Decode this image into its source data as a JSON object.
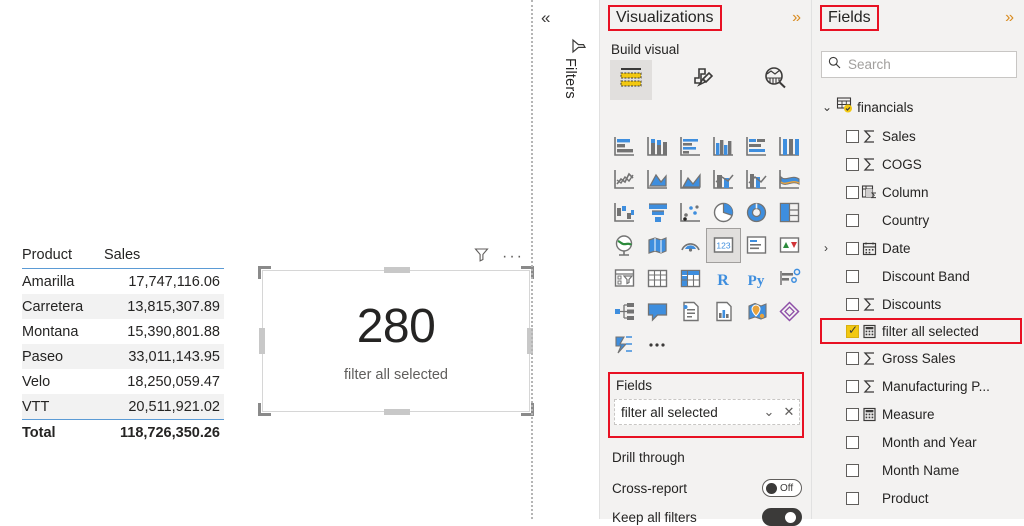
{
  "canvas": {
    "table_visual": {
      "columns": [
        "Product",
        "Sales"
      ],
      "rows": [
        {
          "product": "Amarilla",
          "sales": "17,747,116.06"
        },
        {
          "product": "Carretera",
          "sales": "13,815,307.89"
        },
        {
          "product": "Montana",
          "sales": "15,390,801.88"
        },
        {
          "product": "Paseo",
          "sales": "33,011,143.95"
        },
        {
          "product": "Velo",
          "sales": "18,250,059.47"
        },
        {
          "product": "VTT",
          "sales": "20,511,921.02"
        }
      ],
      "total_label": "Total",
      "total_value": "118,726,350.26"
    },
    "card_visual": {
      "value": "280",
      "label": "filter all selected",
      "filter_icon": "funnel-icon",
      "more_icon": "more-options-ellipsis"
    }
  },
  "filters_rail": {
    "collapse_label": "«",
    "filter_icon": "filter-funnel-icon",
    "label": "Filters"
  },
  "visualizations": {
    "title": "Visualizations",
    "expand_label": "»",
    "build_visual_label": "Build visual",
    "tabs": [
      {
        "name": "build-visual-tab",
        "icon": "build-visual-icon",
        "selected": true
      },
      {
        "name": "format-visual-tab",
        "icon": "paintbrush-icon",
        "selected": false
      },
      {
        "name": "analytics-tab",
        "icon": "magnifier-chart-icon",
        "selected": false
      }
    ],
    "chart_icons": [
      [
        "stacked-bar-chart",
        "stacked-column-chart",
        "clustered-bar-chart",
        "clustered-column-chart",
        "hundred-stacked-bar-chart",
        "hundred-stacked-column-chart"
      ],
      [
        "line-chart",
        "area-chart",
        "stacked-area-chart",
        "line-stacked-column-chart",
        "line-clustered-column-chart",
        "ribbon-chart"
      ],
      [
        "waterfall-chart",
        "funnel-chart",
        "scatter-chart",
        "pie-chart",
        "donut-chart",
        "treemap-chart"
      ],
      [
        "map-chart",
        "filled-map-chart",
        "azure-map-chart",
        "card-visual",
        "multi-row-card",
        "kpi-visual"
      ],
      [
        "slicer-visual",
        "table-visual",
        "matrix-visual",
        "r-script-visual",
        "python-visual",
        "key-influencers"
      ],
      [
        "decomposition-tree",
        "qna-visual",
        "smart-narrative",
        "paginated-report",
        "arcgis-maps",
        "power-apps"
      ],
      [
        "power-automate",
        "more-visuals-ellipsis"
      ]
    ],
    "selected_chart_icon": "card-visual",
    "fields_well": {
      "title": "Fields",
      "chip_value": "filter all selected",
      "chip_dropdown_icon": "chevron-down-icon",
      "chip_remove_icon": "close-icon"
    },
    "drill_through_label": "Drill through",
    "cross_report": {
      "label": "Cross-report",
      "state": "Off"
    },
    "keep_all_filters": {
      "label": "Keep all filters",
      "state": "On"
    }
  },
  "fields": {
    "title": "Fields",
    "expand_label": "»",
    "search": {
      "placeholder": "Search",
      "icon": "search-icon"
    },
    "table_node": {
      "name": "financials",
      "icon": "table-checked-icon",
      "chevron": "chevron-down-icon"
    },
    "items": [
      {
        "label": "Sales",
        "icon": "sigma-icon",
        "checked": false,
        "expandable": false,
        "highlighted": false
      },
      {
        "label": "COGS",
        "icon": "sigma-icon",
        "checked": false,
        "expandable": false,
        "highlighted": false
      },
      {
        "label": "Column",
        "icon": "calc-column-icon",
        "checked": false,
        "expandable": false,
        "highlighted": false
      },
      {
        "label": "Country",
        "icon": "none",
        "checked": false,
        "expandable": false,
        "highlighted": false
      },
      {
        "label": "Date",
        "icon": "calendar-icon",
        "checked": false,
        "expandable": true,
        "highlighted": false
      },
      {
        "label": "Discount Band",
        "icon": "none",
        "checked": false,
        "expandable": false,
        "highlighted": false
      },
      {
        "label": "Discounts",
        "icon": "sigma-icon",
        "checked": false,
        "expandable": false,
        "highlighted": false
      },
      {
        "label": "filter all selected",
        "icon": "measure-icon",
        "checked": true,
        "expandable": false,
        "highlighted": true
      },
      {
        "label": "Gross Sales",
        "icon": "sigma-icon",
        "checked": false,
        "expandable": false,
        "highlighted": false
      },
      {
        "label": "Manufacturing P...",
        "icon": "sigma-icon",
        "checked": false,
        "expandable": false,
        "highlighted": false
      },
      {
        "label": "Measure",
        "icon": "measure-icon",
        "checked": false,
        "expandable": false,
        "highlighted": false
      },
      {
        "label": "Month and Year",
        "icon": "none",
        "checked": false,
        "expandable": false,
        "highlighted": false
      },
      {
        "label": "Month Name",
        "icon": "none",
        "checked": false,
        "expandable": false,
        "highlighted": false
      },
      {
        "label": "Product",
        "icon": "none",
        "checked": false,
        "expandable": false,
        "highlighted": false
      }
    ]
  },
  "colors": {
    "highlight_red": "#e81123",
    "accent_yellow": "#f2c811",
    "chart_blue": "#3e8ede",
    "panel_bg": "#f3f2f1"
  }
}
